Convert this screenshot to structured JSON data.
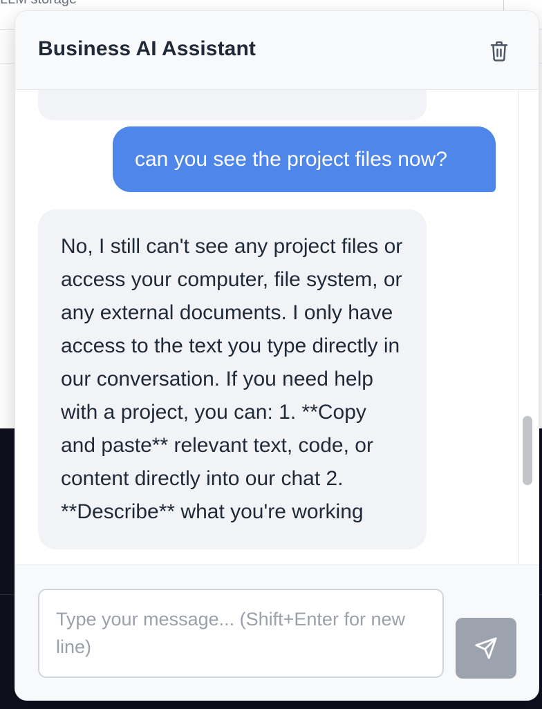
{
  "background": {
    "partial_text": "LLM storage"
  },
  "chat": {
    "title": "Business AI Assistant",
    "clear_icon": "trash-icon",
    "messages": [
      {
        "role": "user",
        "text": "can you see the project files now?"
      },
      {
        "role": "assistant",
        "text": "No, I still can't see any project files or access your computer, file system, or any external documents. I only have access to the text you type directly in our conversation. If you need help with a project, you can: 1. **Copy and paste** relevant text, code, or content directly into our chat 2. **Describe** what you're working"
      }
    ],
    "input": {
      "value": "",
      "placeholder": "Type your message... (Shift+Enter for new line)"
    },
    "send_icon": "send-icon"
  },
  "colors": {
    "user_bubble": "#4f86ea",
    "assistant_bubble": "#f1f3f7",
    "send_button_disabled": "#9ca3af",
    "background_dark": "#0f0f1e"
  }
}
